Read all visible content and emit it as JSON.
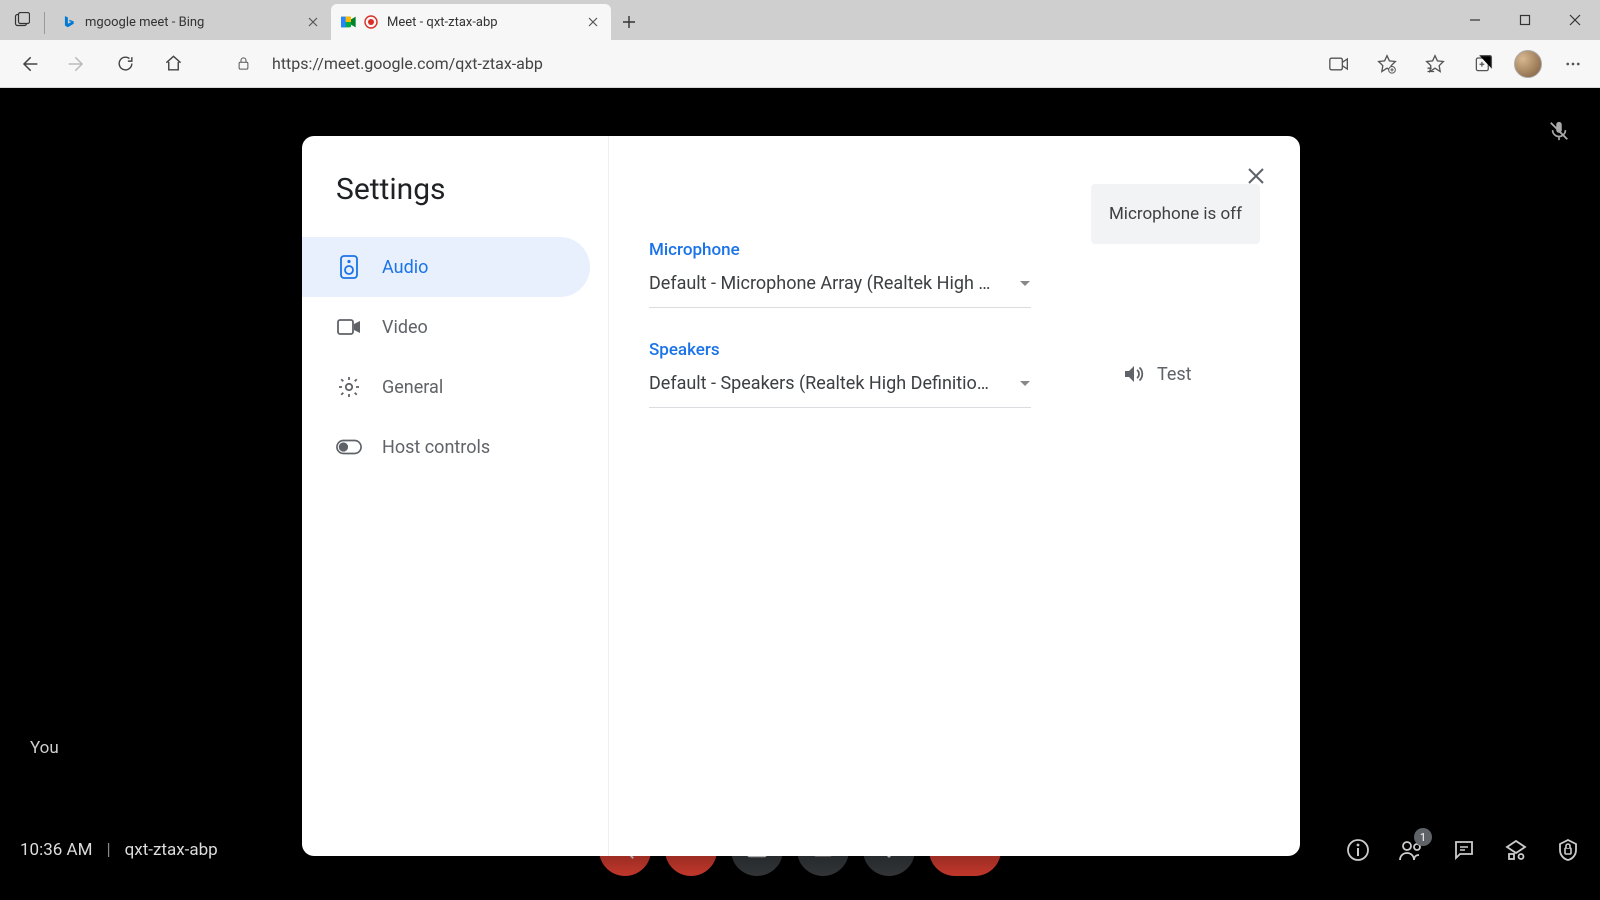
{
  "browser": {
    "tabs": [
      {
        "title": "mgoogle meet - Bing"
      },
      {
        "title": "Meet - qxt-ztax-abp"
      }
    ],
    "url": "https://meet.google.com/qxt-ztax-abp"
  },
  "meet": {
    "you_label": "You",
    "time": "10:36 AM",
    "room_code": "qxt-ztax-abp",
    "participants_badge": "1"
  },
  "settings": {
    "title": "Settings",
    "tabs": {
      "audio": "Audio",
      "video": "Video",
      "general": "General",
      "host": "Host controls"
    },
    "microphone": {
      "label": "Microphone",
      "value": "Default - Microphone Array (Realtek High …",
      "status": "Microphone is off"
    },
    "speakers": {
      "label": "Speakers",
      "value": "Default - Speakers (Realtek High Definitio…",
      "test_label": "Test"
    }
  }
}
